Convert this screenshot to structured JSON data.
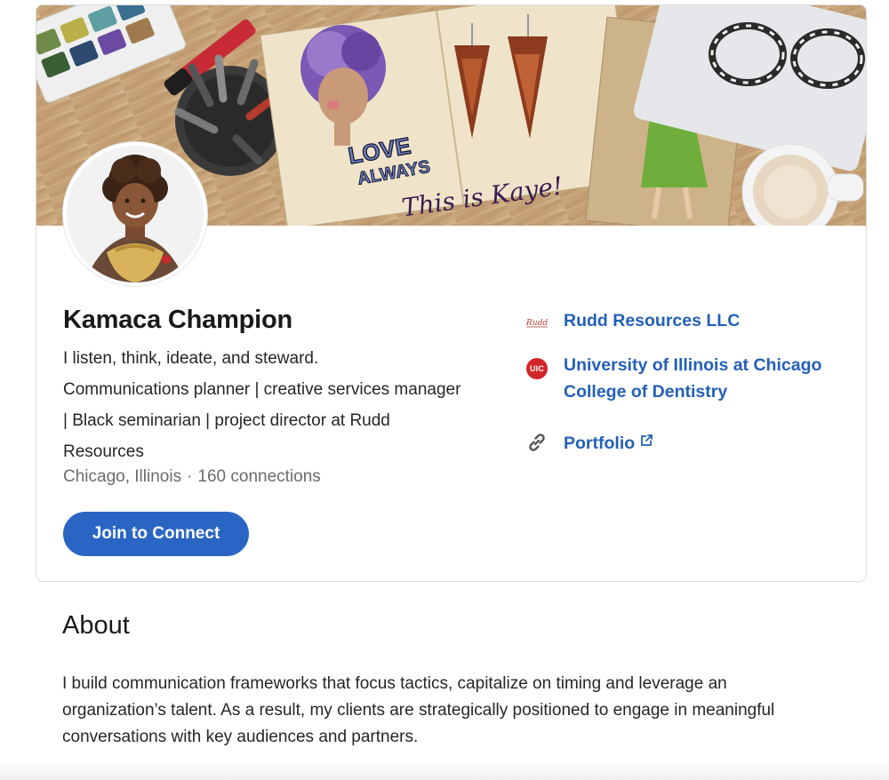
{
  "profile": {
    "name": "Kamaca Champion",
    "headline": "I listen, think, ideate, and steward.\nCommunications planner | creative services manager | Black seminarian | project director at Rudd Resources",
    "headline_line1": "I listen, think, ideate, and steward.",
    "headline_line2": "Communications planner | creative services manager",
    "headline_line3": "| Black seminarian | project director at Rudd",
    "headline_line4": "Resources",
    "location": "Chicago, Illinois",
    "separator": "·",
    "connections": "160 connections",
    "connect_button": "Join to Connect",
    "avatar_icon": "profile-photo",
    "banner_icon": "art-desk-banner",
    "banner_text_love": "LOVE",
    "banner_text_always": "ALWAYS",
    "banner_text_signature": "This is Kaye!"
  },
  "links": {
    "company": {
      "label": "Rudd Resources LLC",
      "logo_text": "Rudd",
      "icon": "company-logo"
    },
    "education": {
      "line1": "University of Illinois at Chicago",
      "line2": "College of Dentistry",
      "logo_text": "UIC",
      "icon": "school-logo"
    },
    "website": {
      "label": "Portfolio",
      "icon": "link-icon",
      "external_icon": "external-link-icon"
    }
  },
  "about": {
    "title": "About",
    "line1": "I build communication frameworks that focus tactics, capitalize on timing and leverage an",
    "line2": "organization’s talent. As a result, my clients are strategically positioned to engage in meaningful",
    "line3": "conversations with key audiences and partners."
  },
  "colors": {
    "link_blue": "#2460b8",
    "button_blue": "#2a65c4",
    "uic_red": "#d2262b",
    "card_border": "#dcdcdc",
    "muted_text": "#6b6b6b"
  }
}
